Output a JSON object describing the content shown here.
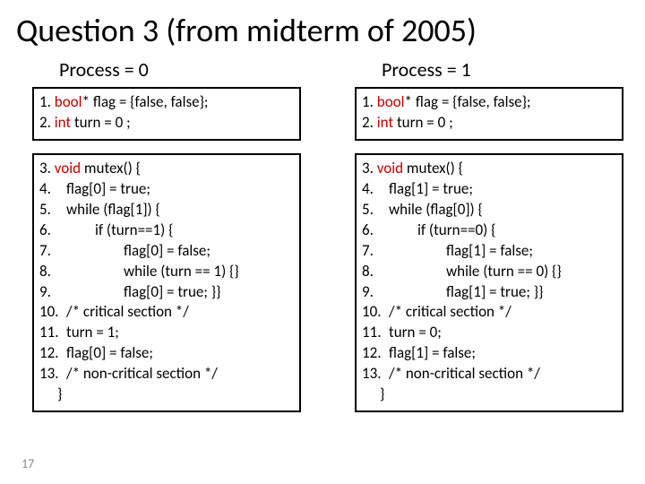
{
  "title": "Question 3 (from midterm of 2005)",
  "page_number": "17",
  "left": {
    "header": "Process = 0",
    "decl": {
      "l1_pre": "1. ",
      "l1_kw": "bool",
      "l1_post": "* flag = {false, false};",
      "l2_pre": "2. ",
      "l2_kw": "int",
      "l2_post": " turn = 0 ;"
    },
    "body": {
      "l3_pre": "3. ",
      "l3_kw": "void",
      "l3_post": " mutex() {",
      "l4_n": "4.",
      "l4_c": "flag[0] = true;",
      "l5_n": "5.",
      "l5_c": "while (flag[1]) {",
      "l6_n": "6.",
      "l6_c": "if (turn==1) {",
      "l7_n": "7.",
      "l7_c": "flag[0] = false;",
      "l8_n": "8.",
      "l8_c": "while (turn == 1) {}",
      "l9_n": "9.",
      "l9_c": "flag[0] = true; }}",
      "l10_n": "10.",
      "l10_c": "/* critical section */",
      "l11_n": "11.",
      "l11_c": "turn = 1;",
      "l12_n": "12.",
      "l12_c": "flag[0] = false;",
      "l13_n": "13.",
      "l13_c": "/* non-critical section */",
      "close": "}"
    }
  },
  "right": {
    "header": "Process = 1",
    "decl": {
      "l1_pre": "1. ",
      "l1_kw": "bool",
      "l1_post": "* flag = {false, false};",
      "l2_pre": "2. ",
      "l2_kw": "int",
      "l2_post": " turn = 0 ;"
    },
    "body": {
      "l3_pre": "3. ",
      "l3_kw": "void",
      "l3_post": " mutex() {",
      "l4_n": "4.",
      "l4_c": "flag[1] = true;",
      "l5_n": "5.",
      "l5_c": "while (flag[0]) {",
      "l6_n": "6.",
      "l6_c": "if (turn==0) {",
      "l7_n": "7.",
      "l7_c": "flag[1] = false;",
      "l8_n": "8.",
      "l8_c": "while (turn == 0) {}",
      "l9_n": "9.",
      "l9_c": "flag[1] = true; }}",
      "l10_n": "10.",
      "l10_c": "/* critical section */",
      "l11_n": "11.",
      "l11_c": "turn = 0;",
      "l12_n": "12.",
      "l12_c": "flag[1] = false;",
      "l13_n": "13.",
      "l13_c": "/* non-critical section */",
      "close": "}"
    }
  }
}
